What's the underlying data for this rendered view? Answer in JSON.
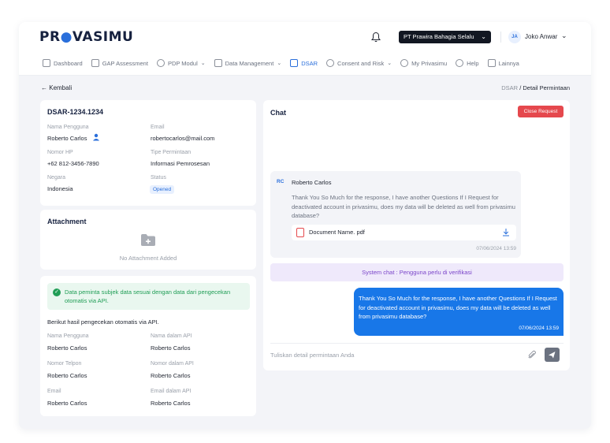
{
  "header": {
    "logo": "PR VASIMU",
    "logo_pre": "PR",
    "logo_post": "VASIMU",
    "company": "PT Prawira Bahagia Selalu",
    "user_initials": "JA",
    "user_name": "Joko Anwar"
  },
  "nav": {
    "items": [
      {
        "label": "Dashboard",
        "icon": "dashboard-icon"
      },
      {
        "label": "GAP Assessment",
        "icon": "gap-icon"
      },
      {
        "label": "PDP Modul",
        "icon": "shield-icon"
      },
      {
        "label": "Data Management",
        "icon": "folder-icon"
      },
      {
        "label": "DSAR",
        "icon": "id-card-icon"
      },
      {
        "label": "Consent and Risk",
        "icon": "info-icon"
      },
      {
        "label": "My Privasimu",
        "icon": "user-icon"
      },
      {
        "label": "Help",
        "icon": "help-icon"
      },
      {
        "label": "Lainnya",
        "icon": "grid-icon"
      }
    ]
  },
  "page": {
    "back": "Kembali",
    "breadcrumb_root": "DSAR",
    "breadcrumb_sep": "/",
    "breadcrumb_current": "Detail Permintaan"
  },
  "request": {
    "id": "DSAR-1234.1234",
    "name_label": "Nama Pengguna",
    "name": "Roberto Carlos",
    "email_label": "Email",
    "email": "robertocarlos@mail.com",
    "phone_label": "Nomor HP",
    "phone": "+62 812-3456-7890",
    "type_label": "Tipe Permintaan",
    "type": "Informasi Pemrosesan",
    "country_label": "Negara",
    "country": "Indonesia",
    "status_label": "Status",
    "status": "Opened"
  },
  "attachment": {
    "title": "Attachment",
    "empty": "No Attachment Added"
  },
  "verification": {
    "notice": "Data peminta subjek data sesuai dengan data dari pengecekan otomatis via API.",
    "intro": "Berikut hasil pengecekan otomatis via API.",
    "rows": [
      {
        "left_label": "Nama Pengguna",
        "left_value": "Roberto Carlos",
        "right_label": "Nama dalam API",
        "right_value": "Roberto Carlos"
      },
      {
        "left_label": "Nomor Telpon",
        "left_value": "Roberto Carlos",
        "right_label": "Nomor dalam API",
        "right_value": "Roberto Carlos"
      },
      {
        "left_label": "Email",
        "left_value": "Roberto Carlos",
        "right_label": "Email dalam API",
        "right_value": "Roberto Carlos"
      }
    ]
  },
  "chat": {
    "title": "Chat",
    "close_button": "Close Request",
    "incoming": {
      "initials": "RC",
      "sender": "Roberto Carlos",
      "text": "Thank You So Much for the response, I have another Questions If I Request for deactivated account in privasimu, does my data will be deleted as well from privasimu database?",
      "attachment": "Document Name. pdf",
      "time": "07/06/2024 13:59"
    },
    "system": "System chat : Pengguna perlu di verifikasi",
    "outgoing": {
      "text": "Thank You So Much for the response, I have another Questions If I Request for deactivated account in privasimu, does my data will be deleted as well from privasimu database?",
      "time": "07/06/2024 13:59"
    },
    "input_placeholder": "Tuliskan detail permintaan Anda"
  },
  "colors": {
    "primary": "#1877e8",
    "danger": "#e5484d",
    "success": "#1f9d55",
    "system": "#7a44c9"
  }
}
